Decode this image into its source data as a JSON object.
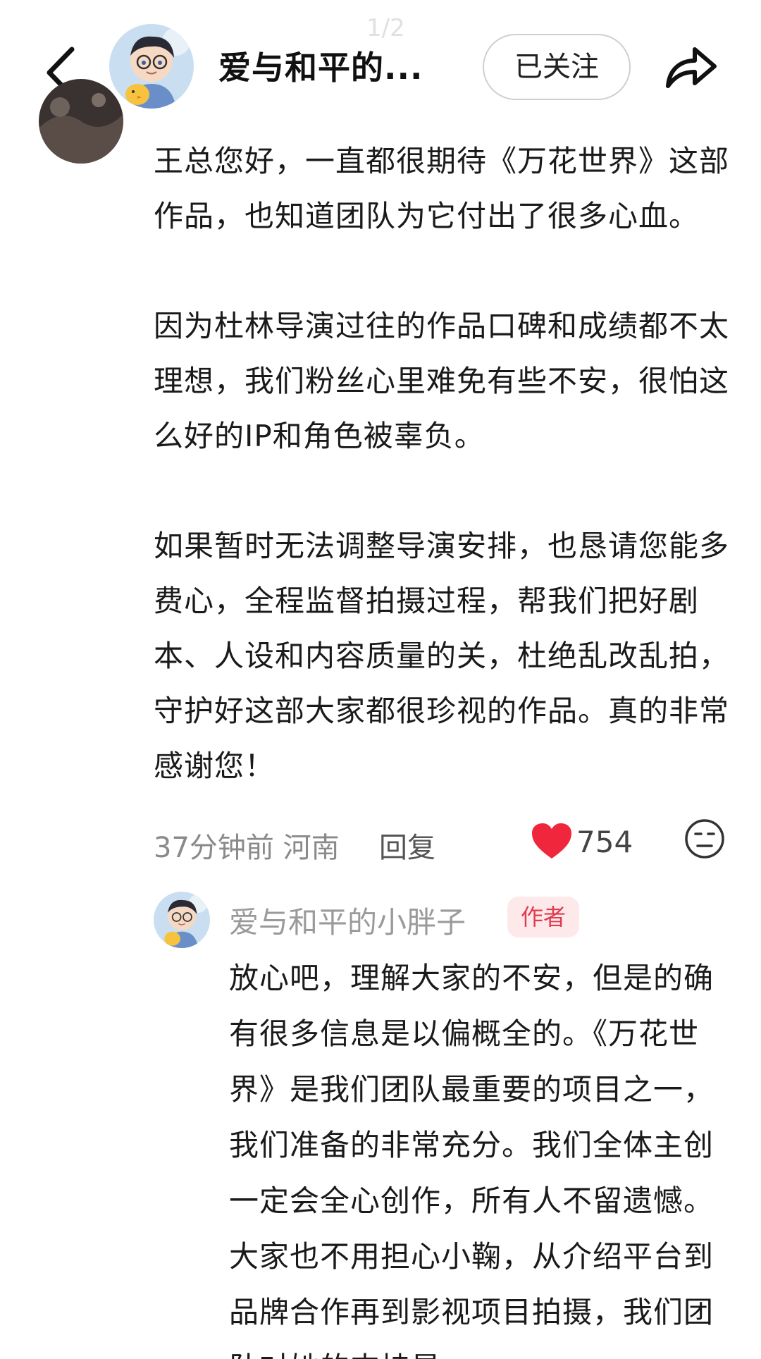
{
  "header": {
    "username": "爱与和平的...",
    "follow_label": "已关注",
    "page_indicator": "1/2"
  },
  "comment": {
    "paragraphs": [
      "王总您好，一直都很期待《万花世界》这部作品，也知道团队为它付出了很多心血。",
      "因为杜林导演过往的作品口碑和成绩都不太理想，我们粉丝心里难免有些不安，很怕这么好的IP和角色被辜负。",
      "如果暂时无法调整导演安排，也恳请您能多费心，全程监督拍摄过程，帮我们把好剧本、人设和内容质量的关，杜绝乱改乱拍，守护好这部大家都很珍视的作品。真的非常感谢您！"
    ],
    "time": "37分钟前",
    "location": "河南",
    "reply_label": "回复",
    "like_count": "754"
  },
  "reply": {
    "author": "爱与和平的小胖子",
    "badge": "作者",
    "text": "放心吧，理解大家的不安，但是的确有很多信息是以偏概全的。《万花世界》是我们团队最重要的项目之一，我们准备的非常充分。我们全体主创一定会全心创作，所有人不留遗憾。大家也不用担心小鞠，从介绍平台到品牌合作再到影视项目拍摄，我们团队对她的支持是..."
  },
  "colors": {
    "like": "#f0263c",
    "badge_bg": "#fde8ea",
    "badge_text": "#e03a4e"
  }
}
